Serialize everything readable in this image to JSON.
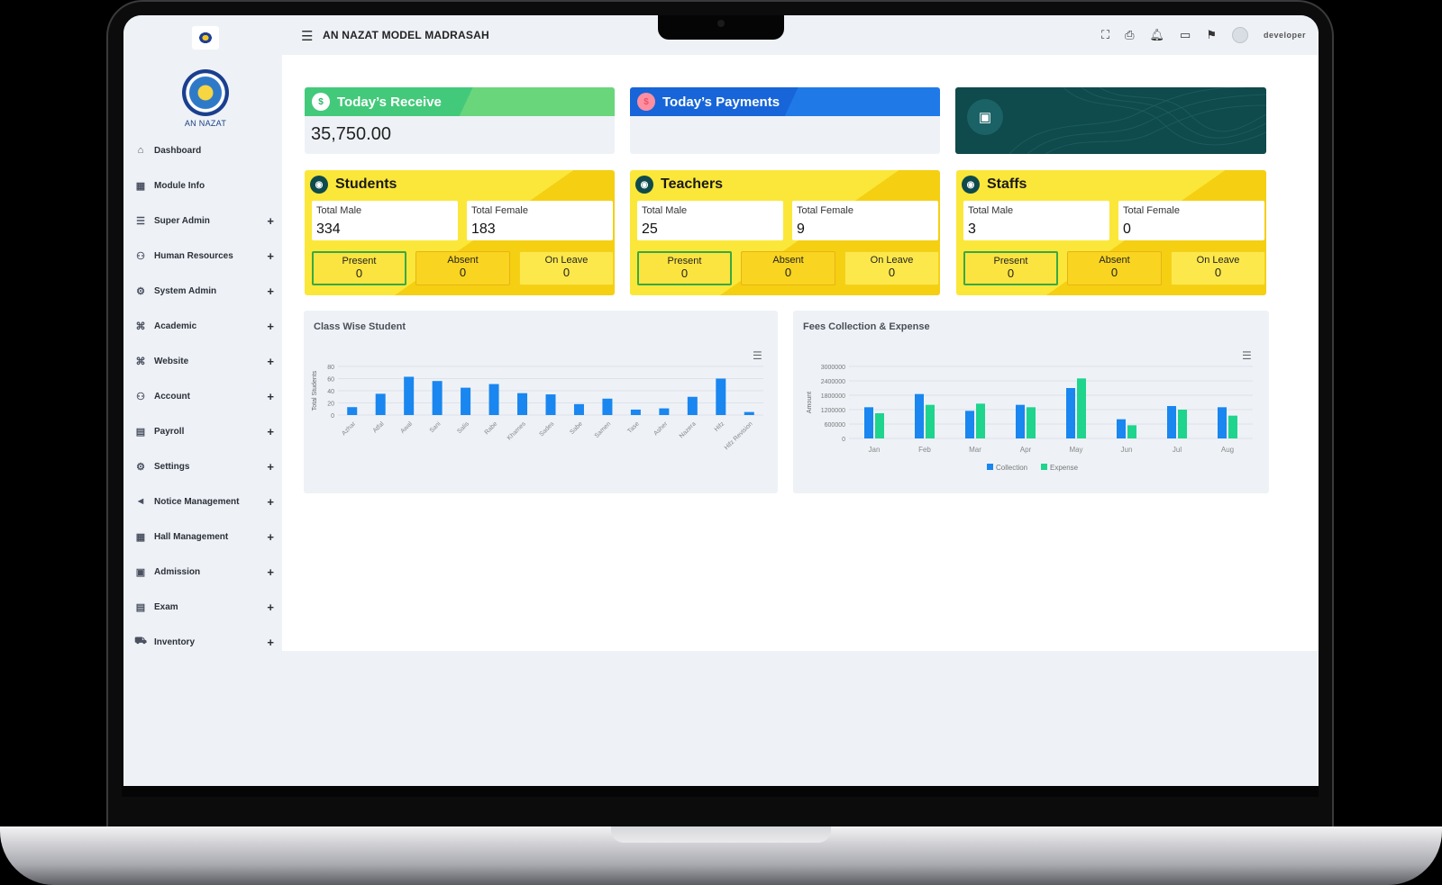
{
  "app": {
    "school_name": "AN NAZAT MODEL MADRASAH",
    "logo_text": "AN NAZAT",
    "user": "developer"
  },
  "sidebar": {
    "items": [
      {
        "label": "Dashboard",
        "icon": "home-icon",
        "expand": false
      },
      {
        "label": "Module Info",
        "icon": "grid-icon",
        "expand": false
      },
      {
        "label": "Super Admin",
        "icon": "server-icon",
        "expand": true
      },
      {
        "label": "Human Resources",
        "icon": "users-icon",
        "expand": true
      },
      {
        "label": "System Admin",
        "icon": "user-cog-icon",
        "expand": true
      },
      {
        "label": "Academic",
        "icon": "graduation-cap-icon",
        "expand": true
      },
      {
        "label": "Website",
        "icon": "globe-cap-icon",
        "expand": true
      },
      {
        "label": "Account",
        "icon": "account-icon",
        "expand": true
      },
      {
        "label": "Payroll",
        "icon": "payroll-icon",
        "expand": true
      },
      {
        "label": "Settings",
        "icon": "gear-icon",
        "expand": true
      },
      {
        "label": "Notice Management",
        "icon": "megaphone-icon",
        "expand": true
      },
      {
        "label": "Hall Management",
        "icon": "building-icon",
        "expand": true
      },
      {
        "label": "Admission",
        "icon": "admission-icon",
        "expand": true
      },
      {
        "label": "Exam",
        "icon": "list-icon",
        "expand": true
      },
      {
        "label": "Inventory",
        "icon": "cart-icon",
        "expand": true
      }
    ],
    "plus_glyph": "+"
  },
  "cards": {
    "receive": {
      "title": "Today’s Receive",
      "amount": "35,750.00"
    },
    "payments": {
      "title": "Today’s Payments",
      "amount": ""
    },
    "students": {
      "title": "Students",
      "total_male_label": "Total Male",
      "total_male": "334",
      "total_female_label": "Total Female",
      "total_female": "183",
      "present_label": "Present",
      "present": "0",
      "absent_label": "Absent",
      "absent": "0",
      "leave_label": "On Leave",
      "leave": "0"
    },
    "teachers": {
      "title": "Teachers",
      "total_male_label": "Total Male",
      "total_male": "25",
      "total_female_label": "Total Female",
      "total_female": "9",
      "present_label": "Present",
      "present": "0",
      "absent_label": "Absent",
      "absent": "0",
      "leave_label": "On Leave",
      "leave": "0"
    },
    "staffs": {
      "title": "Staffs",
      "total_male_label": "Total Male",
      "total_male": "3",
      "total_female_label": "Total Female",
      "total_female": "0",
      "present_label": "Present",
      "present": "0",
      "absent_label": "Absent",
      "absent": "0",
      "leave_label": "On Leave",
      "leave": "0"
    }
  },
  "colors": {
    "receive": "#43c97a",
    "payments": "#1765d8",
    "wallet": "#0f4a4c",
    "stat_yellow": "#fbe73a",
    "collection": "#1a86f0",
    "expense": "#1fd48c"
  },
  "chart_data": [
    {
      "type": "bar",
      "title": "Class Wise Student",
      "ylabel": "Total Students",
      "xlabel": "",
      "categories": [
        "Azhar",
        "Atfal",
        "Awal",
        "Sani",
        "Salis",
        "Rabe",
        "Khames",
        "Sades",
        "Sabe",
        "Samen",
        "Tase",
        "Asher",
        "Nazera",
        "Hifz",
        "Hifz Revision"
      ],
      "values": [
        13,
        35,
        63,
        56,
        45,
        51,
        36,
        34,
        18,
        27,
        9,
        11,
        30,
        60,
        5
      ],
      "ylim": [
        0,
        80
      ],
      "yticks": [
        "0",
        "20",
        "40",
        "60",
        "80"
      ],
      "legend": "none",
      "grid": "horizontal"
    },
    {
      "type": "bar",
      "title": "Fees Collection & Expense",
      "ylabel": "Amount",
      "xlabel": "",
      "categories": [
        "Jan",
        "Feb",
        "Mar",
        "Apr",
        "May",
        "Jun",
        "Jul",
        "Aug"
      ],
      "series": [
        {
          "name": "Collection",
          "values": [
            1300000,
            1850000,
            1150000,
            1400000,
            2100000,
            800000,
            1350000,
            1300000
          ]
        },
        {
          "name": "Expense",
          "values": [
            1050000,
            1400000,
            1450000,
            1300000,
            2500000,
            550000,
            1200000,
            950000
          ]
        }
      ],
      "ylim": [
        0,
        3000000
      ],
      "yticks": [
        "0",
        "600000",
        "1200000",
        "1800000",
        "2400000",
        "3000000"
      ],
      "legend": "bottom-center",
      "grid": "horizontal"
    }
  ]
}
